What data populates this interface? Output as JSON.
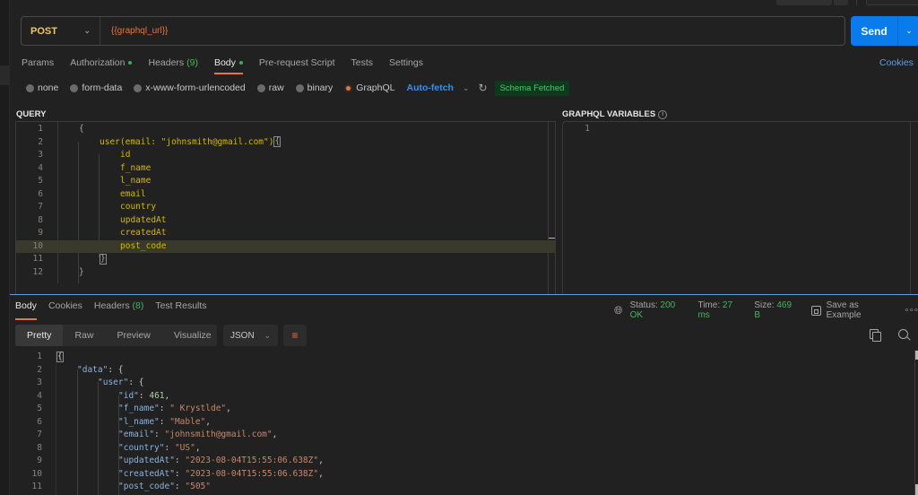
{
  "request": {
    "method": "POST",
    "url": "{{graphql_url}}",
    "send_label": "Send",
    "tabs": [
      {
        "label": "Params",
        "count": "",
        "dot": false,
        "active": false
      },
      {
        "label": "Authorization",
        "count": "",
        "dot": true,
        "active": false
      },
      {
        "label": "Headers",
        "count": "(9)",
        "dot": false,
        "active": false
      },
      {
        "label": "Body",
        "count": "",
        "dot": true,
        "active": true
      },
      {
        "label": "Pre-request Script",
        "count": "",
        "dot": false,
        "active": false
      },
      {
        "label": "Tests",
        "count": "",
        "dot": false,
        "active": false
      },
      {
        "label": "Settings",
        "count": "",
        "dot": false,
        "active": false
      }
    ],
    "cookies_label": "Cookies",
    "body_types": [
      "none",
      "form-data",
      "x-www-form-urlencoded",
      "raw",
      "binary",
      "GraphQL"
    ],
    "body_type_selected": "GraphQL",
    "autofetch_label": "Auto-fetch",
    "schema_badge": "Schema Fetched"
  },
  "query": {
    "label": "QUERY",
    "lines": [
      {
        "n": "1",
        "text": "{",
        "indent": 0,
        "brace": true
      },
      {
        "n": "2",
        "text": "user(email: \"johnsmith@gmail.com\")",
        "indent": 1,
        "brace": false,
        "suffix": "{"
      },
      {
        "n": "3",
        "text": "id",
        "indent": 2,
        "brace": false
      },
      {
        "n": "4",
        "text": "f_name",
        "indent": 2,
        "brace": false
      },
      {
        "n": "5",
        "text": "l_name",
        "indent": 2,
        "brace": false
      },
      {
        "n": "6",
        "text": "email",
        "indent": 2,
        "brace": false
      },
      {
        "n": "7",
        "text": "country",
        "indent": 2,
        "brace": false
      },
      {
        "n": "8",
        "text": "updatedAt",
        "indent": 2,
        "brace": false
      },
      {
        "n": "9",
        "text": "createdAt",
        "indent": 2,
        "brace": false
      },
      {
        "n": "10",
        "text": "post_code",
        "indent": 2,
        "brace": false,
        "highlight": true
      },
      {
        "n": "11",
        "text": "}",
        "indent": 1,
        "brace": true,
        "boxed": true
      },
      {
        "n": "12",
        "text": "}",
        "indent": 0,
        "brace": true
      }
    ]
  },
  "variables": {
    "label": "GRAPHQL VARIABLES",
    "line1": "1"
  },
  "response": {
    "tabs": [
      {
        "label": "Body",
        "count": "",
        "active": true
      },
      {
        "label": "Cookies",
        "count": "",
        "active": false
      },
      {
        "label": "Headers",
        "count": "(8)",
        "active": false
      },
      {
        "label": "Test Results",
        "count": "",
        "active": false
      }
    ],
    "status_label": "Status:",
    "status_value": "200 OK",
    "time_label": "Time:",
    "time_value": "27 ms",
    "size_label": "Size:",
    "size_value": "469 B",
    "save_example": "Save as Example",
    "views": [
      "Pretty",
      "Raw",
      "Preview",
      "Visualize"
    ],
    "view_active": "Pretty",
    "format": "JSON",
    "body_lines": [
      {
        "n": "1",
        "indent": 0,
        "parts": [
          [
            "pun",
            "{"
          ]
        ]
      },
      {
        "n": "2",
        "indent": 1,
        "parts": [
          [
            "key",
            "\"data\""
          ],
          [
            "pun",
            ": {"
          ]
        ]
      },
      {
        "n": "3",
        "indent": 2,
        "parts": [
          [
            "key",
            "\"user\""
          ],
          [
            "pun",
            ": {"
          ]
        ]
      },
      {
        "n": "4",
        "indent": 3,
        "parts": [
          [
            "key",
            "\"id\""
          ],
          [
            "pun",
            ": "
          ],
          [
            "num",
            "461"
          ],
          [
            "pun",
            ","
          ]
        ]
      },
      {
        "n": "5",
        "indent": 3,
        "parts": [
          [
            "key",
            "\"f_name\""
          ],
          [
            "pun",
            ": "
          ],
          [
            "str",
            "\" Krystlde\""
          ],
          [
            "pun",
            ","
          ]
        ]
      },
      {
        "n": "6",
        "indent": 3,
        "parts": [
          [
            "key",
            "\"l_name\""
          ],
          [
            "pun",
            ": "
          ],
          [
            "str",
            "\"Mable\""
          ],
          [
            "pun",
            ","
          ]
        ]
      },
      {
        "n": "7",
        "indent": 3,
        "parts": [
          [
            "key",
            "\"email\""
          ],
          [
            "pun",
            ": "
          ],
          [
            "str",
            "\"johnsmith@gmail.com\""
          ],
          [
            "pun",
            ","
          ]
        ]
      },
      {
        "n": "8",
        "indent": 3,
        "parts": [
          [
            "key",
            "\"country\""
          ],
          [
            "pun",
            ": "
          ],
          [
            "str",
            "\"US\""
          ],
          [
            "pun",
            ","
          ]
        ]
      },
      {
        "n": "9",
        "indent": 3,
        "parts": [
          [
            "key",
            "\"updatedAt\""
          ],
          [
            "pun",
            ": "
          ],
          [
            "str",
            "\"2023-08-04T15:55:06.638Z\""
          ],
          [
            "pun",
            ","
          ]
        ]
      },
      {
        "n": "10",
        "indent": 3,
        "parts": [
          [
            "key",
            "\"createdAt\""
          ],
          [
            "pun",
            ": "
          ],
          [
            "str",
            "\"2023-08-04T15:55:06.638Z\""
          ],
          [
            "pun",
            ","
          ]
        ]
      },
      {
        "n": "11",
        "indent": 3,
        "parts": [
          [
            "key",
            "\"post_code\""
          ],
          [
            "pun",
            ": "
          ],
          [
            "str",
            "\"505\""
          ]
        ]
      }
    ]
  }
}
